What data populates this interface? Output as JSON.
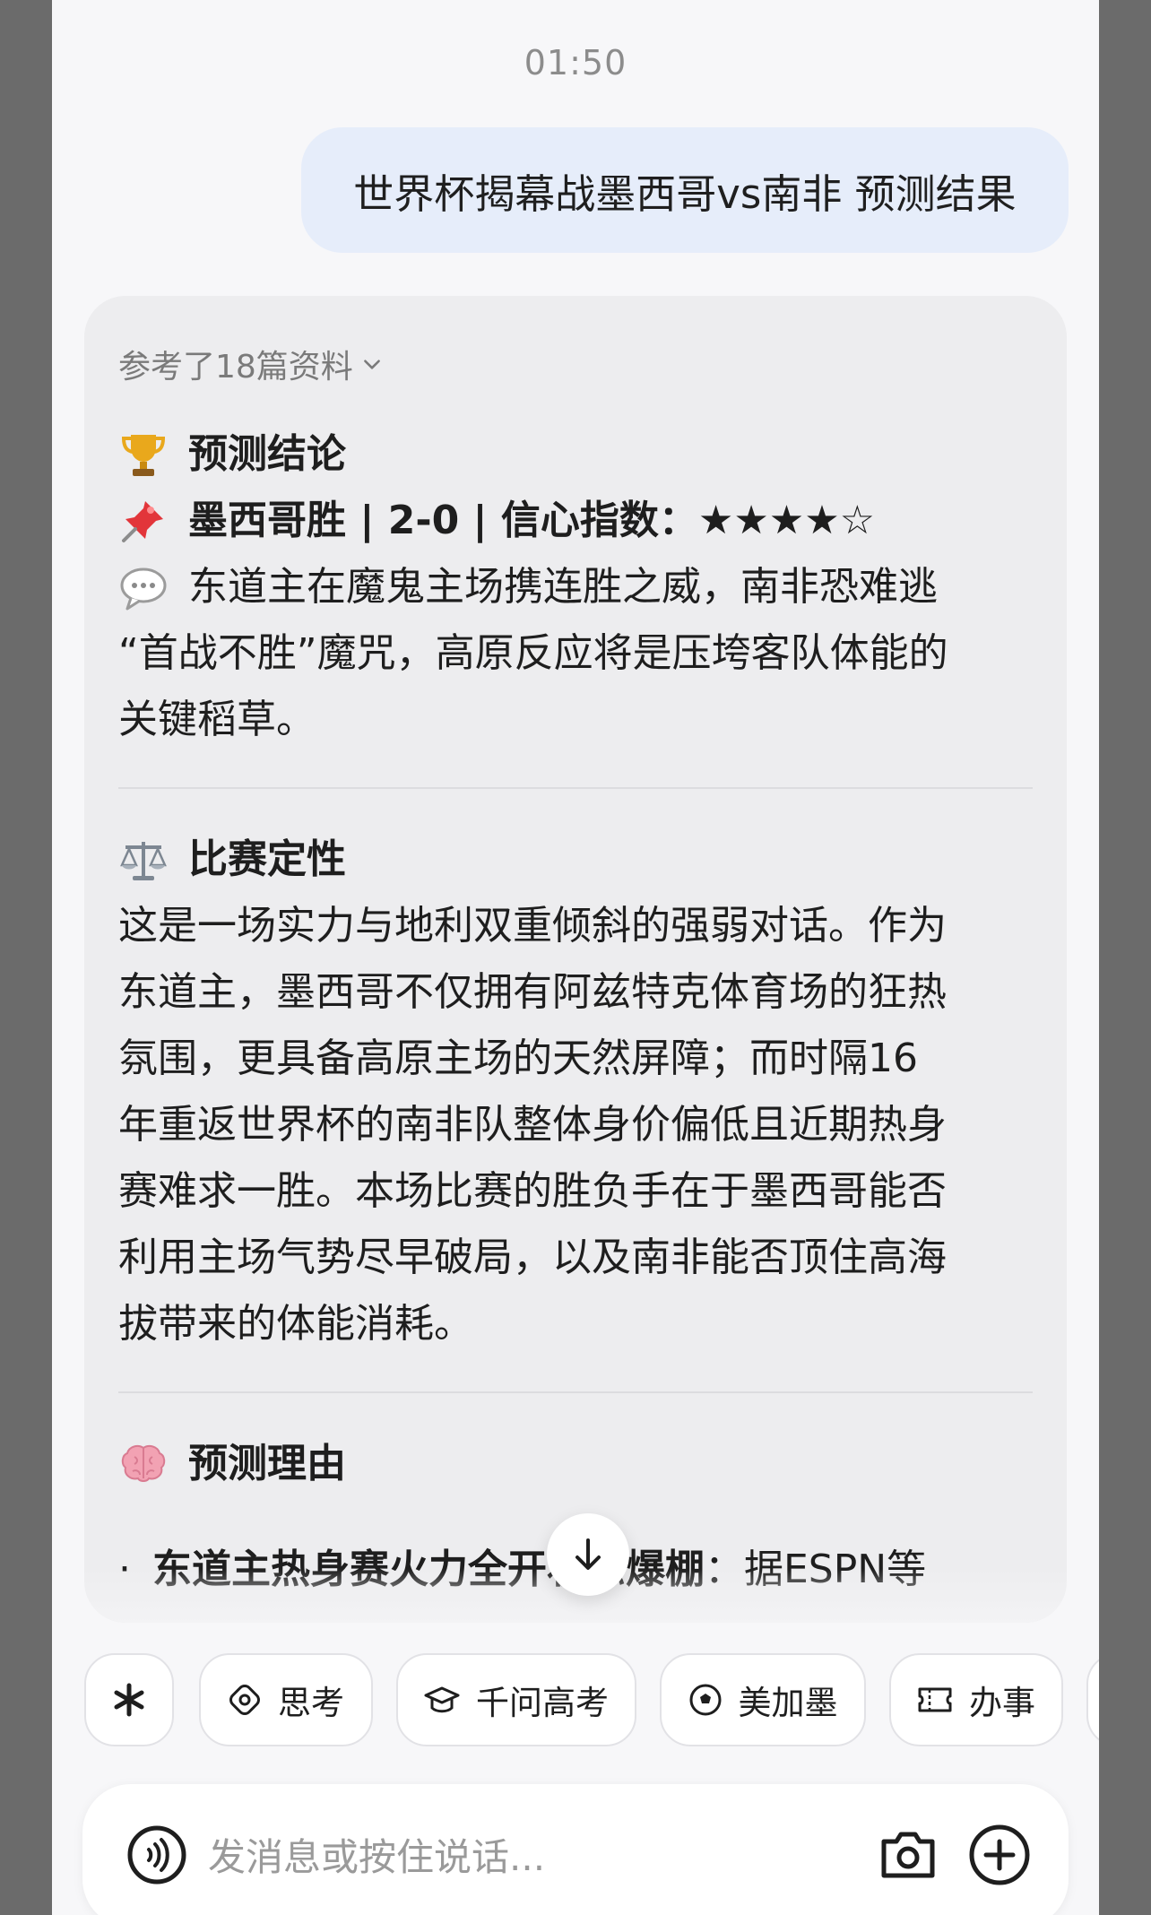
{
  "status": {
    "time": "01:50"
  },
  "user_message": "世界杯揭幕战墨西哥vs南非 预测结果",
  "answer": {
    "references": "参考了18篇资料",
    "conclusion_heading": "预测结论",
    "prediction_line": "墨西哥胜 | 2-0 | 信心指数：★★★★☆",
    "summary_lines": [
      "东道主在魔鬼主场携连胜之威，南非恐难逃",
      "“首战不胜”魔咒，高原反应将是压垮客队体能的",
      "关键稻草。"
    ],
    "nature_heading": "比赛定性",
    "nature_lines": [
      "这是一场实力与地利双重倾斜的强弱对话。作为",
      "东道主，墨西哥不仅拥有阿兹特克体育场的狂热",
      "氛围，更具备高原主场的天然屏障；而时隔16",
      "年重返世界杯的南非队整体身价偏低且近期热身",
      "赛难求一胜。本场比赛的胜负手在于墨西哥能否",
      "利用主场气势尽早破局，以及南非能否顶住高海",
      "拔带来的体能消耗。"
    ],
    "reason_heading": "预测理由",
    "reason_bullet_bold": "东道主热身赛火力全开状态爆棚",
    "reason_bullet_rest": "：据ESPN等"
  },
  "chips": [
    {
      "label": "",
      "icon": "sparkle-icon"
    },
    {
      "label": "思考",
      "icon": "think-icon"
    },
    {
      "label": "千问高考",
      "icon": "graduation-cap-icon"
    },
    {
      "label": "美加墨",
      "icon": "soccer-ball-icon"
    },
    {
      "label": "办事",
      "icon": "ticket-icon"
    }
  ],
  "input": {
    "placeholder": "发消息或按住说话..."
  }
}
